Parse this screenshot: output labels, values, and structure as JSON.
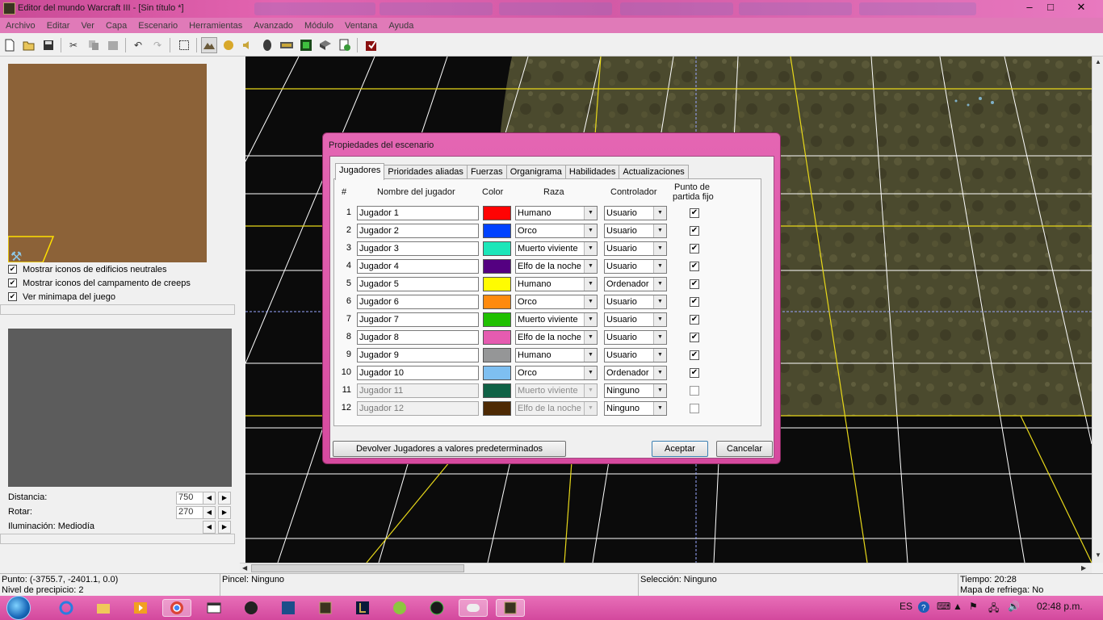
{
  "window": {
    "title": "Editor del mundo Warcraft III  - [Sin título *]",
    "minimize": "–",
    "maximize": "□",
    "close": "✕"
  },
  "menubar": [
    "Archivo",
    "Editar",
    "Ver",
    "Capa",
    "Escenario",
    "Herramientas",
    "Avanzado",
    "Módulo",
    "Ventana",
    "Ayuda"
  ],
  "toolbar": {
    "icons": [
      "new-icon",
      "open-icon",
      "save-icon",
      "cut-icon",
      "copy-icon",
      "paste-icon",
      "undo-icon",
      "redo-icon",
      "select-icon",
      "terrain-palette-icon",
      "unit-palette-icon",
      "sound-icon",
      "object-editor-icon",
      "trigger-editor-icon",
      "import-manager-icon",
      "ai-editor-icon",
      "campaign-editor-icon",
      "test-map-icon"
    ]
  },
  "left_panel": {
    "checkboxes": [
      {
        "label": "Mostrar iconos de edificios neutrales",
        "checked": true
      },
      {
        "label": "Mostrar iconos del campamento de creeps",
        "checked": true
      },
      {
        "label": "Ver minimapa del juego",
        "checked": true
      }
    ],
    "distance_label": "Distancia:",
    "distance_value": "750",
    "rotate_label": "Rotar:",
    "rotate_value": "270",
    "lighting_label": "Iluminación: Mediodía"
  },
  "dialog": {
    "title": "Propiedades del escenario",
    "tabs": [
      "Jugadores",
      "Prioridades aliadas",
      "Fuerzas",
      "Organigrama",
      "Habilidades",
      "Actualizaciones"
    ],
    "active_tab": "Jugadores",
    "headers": {
      "num": "#",
      "name": "Nombre del jugador",
      "color": "Color",
      "race": "Raza",
      "controller": "Controlador",
      "fixed_start_1": "Punto de",
      "fixed_start_2": "partida fijo"
    },
    "players": [
      {
        "num": "1",
        "name": "Jugador 1",
        "color": "#ff0303",
        "race": "Humano",
        "controller": "Usuario",
        "fixed": true,
        "enabled": true
      },
      {
        "num": "2",
        "name": "Jugador 2",
        "color": "#0042ff",
        "race": "Orco",
        "controller": "Usuario",
        "fixed": true,
        "enabled": true
      },
      {
        "num": "3",
        "name": "Jugador 3",
        "color": "#1ce6b9",
        "race": "Muerto viviente",
        "controller": "Usuario",
        "fixed": true,
        "enabled": true
      },
      {
        "num": "4",
        "name": "Jugador 4",
        "color": "#540081",
        "race": "Elfo de la noche",
        "controller": "Usuario",
        "fixed": true,
        "enabled": true
      },
      {
        "num": "5",
        "name": "Jugador 5",
        "color": "#fffc01",
        "race": "Humano",
        "controller": "Ordenador",
        "fixed": true,
        "enabled": true
      },
      {
        "num": "6",
        "name": "Jugador 6",
        "color": "#fe8a0e",
        "race": "Orco",
        "controller": "Usuario",
        "fixed": true,
        "enabled": true
      },
      {
        "num": "7",
        "name": "Jugador 7",
        "color": "#20c000",
        "race": "Muerto viviente",
        "controller": "Usuario",
        "fixed": true,
        "enabled": true
      },
      {
        "num": "8",
        "name": "Jugador 8",
        "color": "#e55bb0",
        "race": "Elfo de la noche",
        "controller": "Usuario",
        "fixed": true,
        "enabled": true
      },
      {
        "num": "9",
        "name": "Jugador 9",
        "color": "#959697",
        "race": "Humano",
        "controller": "Usuario",
        "fixed": true,
        "enabled": true
      },
      {
        "num": "10",
        "name": "Jugador 10",
        "color": "#7ebff1",
        "race": "Orco",
        "controller": "Ordenador",
        "fixed": true,
        "enabled": true
      },
      {
        "num": "11",
        "name": "Jugador 11",
        "color": "#106246",
        "race": "Muerto viviente",
        "controller": "Ninguno",
        "fixed": false,
        "enabled": false
      },
      {
        "num": "12",
        "name": "Jugador 12",
        "color": "#4e2a04",
        "race": "Elfo de la noche",
        "controller": "Ninguno",
        "fixed": false,
        "enabled": false
      }
    ],
    "reset_button": "Devolver Jugadores a valores predeterminados",
    "ok_button": "Aceptar",
    "cancel_button": "Cancelar"
  },
  "statusbar": {
    "point": "Punto: (-3755.7, -2401.1, 0.0)",
    "cliff_level": "Nivel de precipicio: 2",
    "brush": "Pincel: Ninguno",
    "selection": "Selección: Ninguno",
    "time": "Tiempo: 20:28",
    "refresh_map": "Mapa de refriega: No"
  },
  "taskbar": {
    "language": "ES",
    "clock": "02:48 p.m."
  }
}
